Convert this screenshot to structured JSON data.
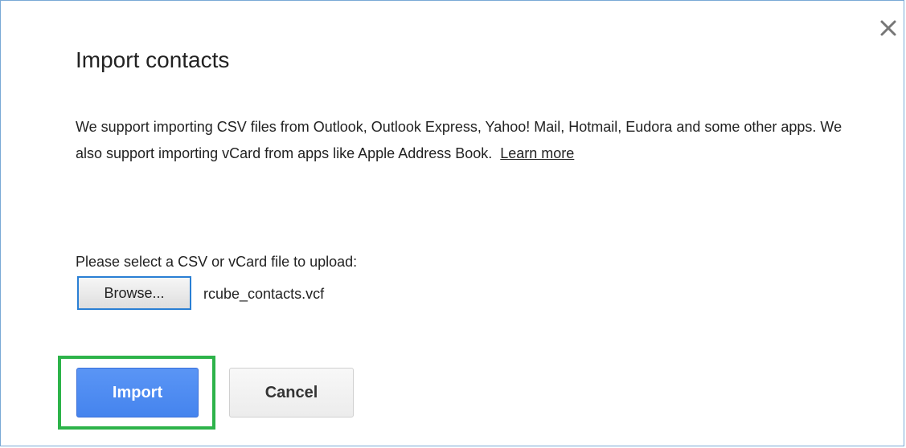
{
  "dialog": {
    "title": "Import contacts",
    "close_icon": "close-icon",
    "description": "We support importing CSV files from Outlook, Outlook Express, Yahoo! Mail, Hotmail, Eudora and some other apps. We also support importing vCard from apps like Apple Address Book.",
    "learn_more_label": "Learn more",
    "select_label": "Please select a CSV or vCard file to upload:",
    "browse_label": "Browse...",
    "file_name": "rcube_contacts.vcf",
    "import_label": "Import",
    "cancel_label": "Cancel"
  },
  "colors": {
    "primary_button": "#4a89f0",
    "highlight": "#2db34a",
    "focus_border": "#2a7fd4",
    "dialog_border": "#7aa9d6"
  }
}
